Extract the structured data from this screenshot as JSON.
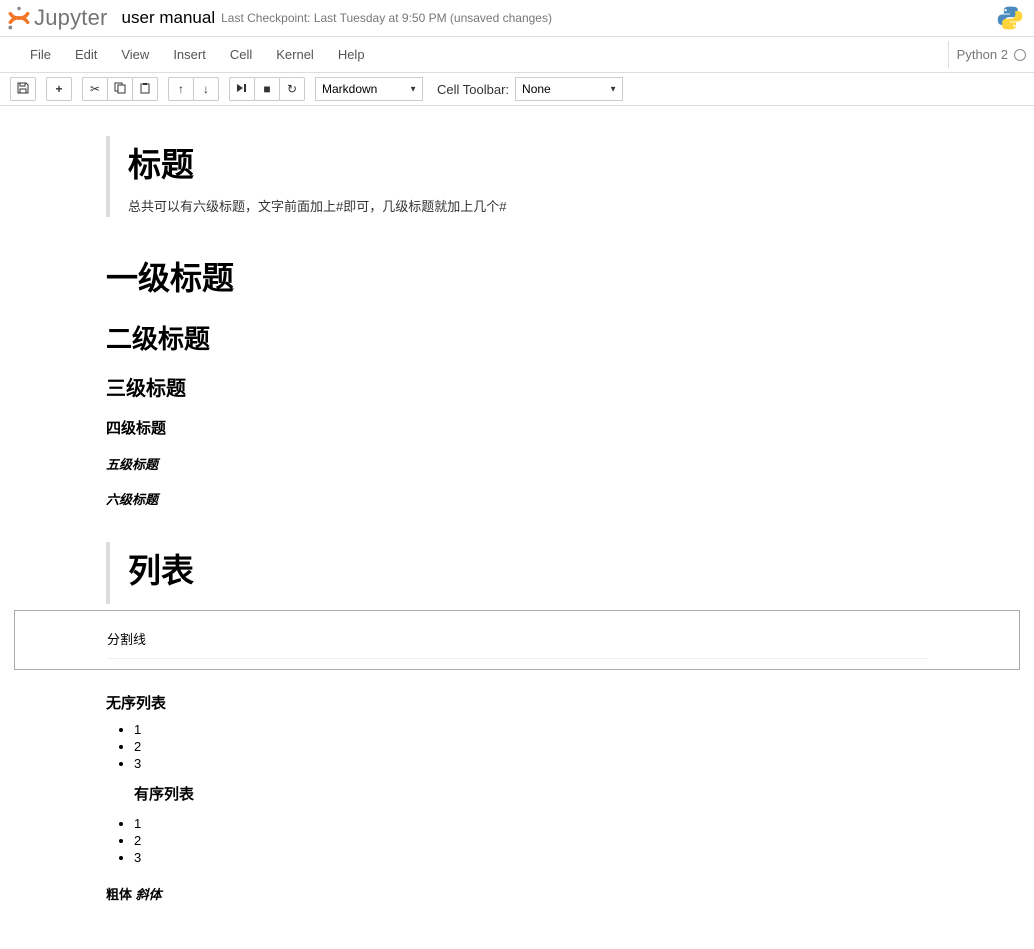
{
  "header": {
    "logo_text": "Jupyter",
    "notebook_name": "user manual",
    "checkpoint": "Last Checkpoint: Last Tuesday at 9:50 PM (unsaved changes)"
  },
  "menubar": {
    "items": [
      "File",
      "Edit",
      "View",
      "Insert",
      "Cell",
      "Kernel",
      "Help"
    ],
    "kernel": "Python 2"
  },
  "toolbar": {
    "save": "💾",
    "add": "✚",
    "cut": "✂",
    "copy": "⿻",
    "paste": "📋",
    "up": "▲",
    "down": "▼",
    "run": "▶|",
    "stop": "■",
    "restart": "↻",
    "cell_type": "Markdown",
    "cell_toolbar_label": "Cell Toolbar:",
    "cell_toolbar_value": "None"
  },
  "content": {
    "bq1_title": "标题",
    "bq1_text": "总共可以有六级标题，文字前面加上#即可，几级标题就加上几个#",
    "h1": "一级标题",
    "h2": "二级标题",
    "h3": "三级标题",
    "h4": "四级标题",
    "h5": "五级标题",
    "h6": "六级标题",
    "bq2_title": "列表",
    "sep_label": "分割线",
    "ul_label": "无序列表",
    "ul_items": [
      "1",
      "2",
      "3"
    ],
    "ol_label": "有序列表",
    "ol_items": [
      "1",
      "2",
      "3"
    ],
    "bold_label": "粗体",
    "italic_label": "斜体"
  }
}
